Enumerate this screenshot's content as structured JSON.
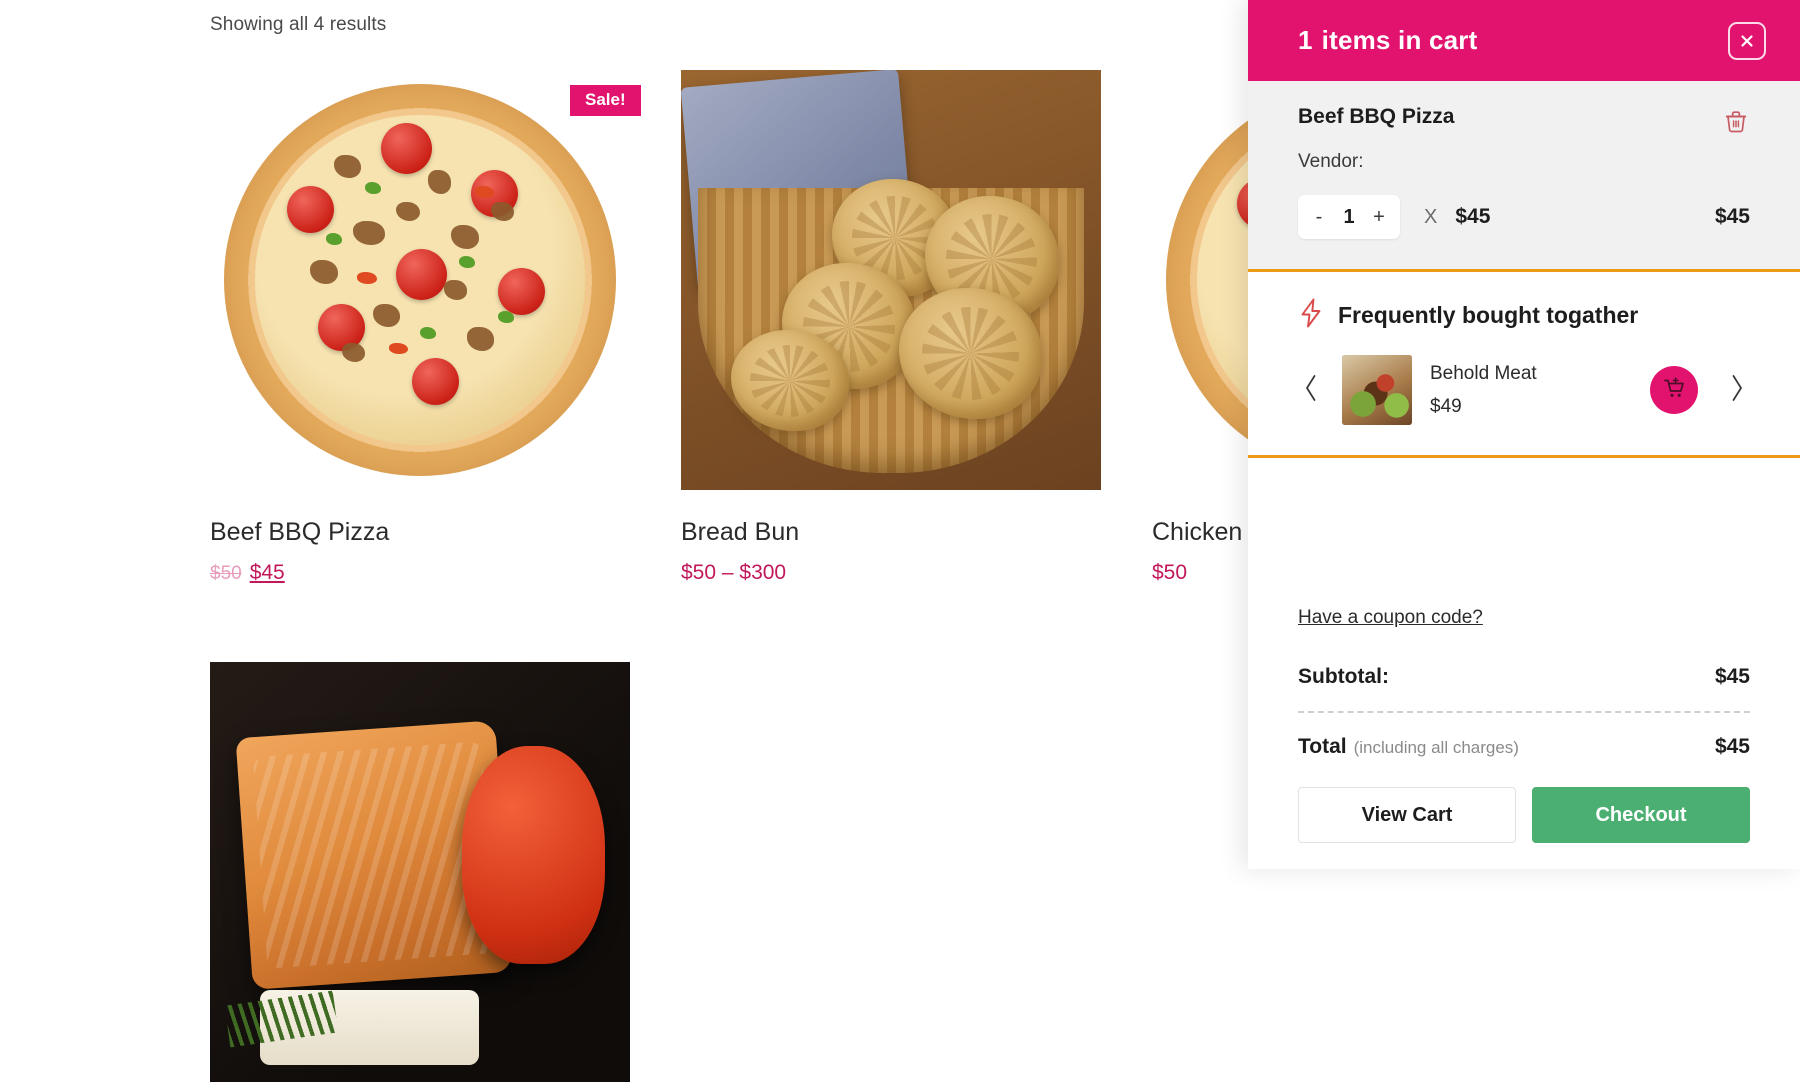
{
  "shop": {
    "results_text": "Showing all 4 results",
    "sale_badge": "Sale!",
    "products": [
      {
        "title": "Beef BBQ Pizza",
        "old_price": "$50",
        "price": "$45",
        "on_sale": true,
        "image": "beef-bbq-pizza-photo"
      },
      {
        "title": "Bread Bun",
        "price": "$50 – $300",
        "on_sale": false,
        "image": "bread-bun-basket-photo"
      },
      {
        "title": "Chicken",
        "price": "$50",
        "on_sale": false,
        "image": "chicken-pizza-photo"
      },
      {
        "title": "",
        "price": "",
        "on_sale": false,
        "image": "grilled-salmon-photo"
      }
    ]
  },
  "cart": {
    "header": {
      "count": "1",
      "title": "items in cart",
      "close_icon": "close-icon"
    },
    "item": {
      "name": "Beef BBQ Pizza",
      "vendor_label": "Vendor:",
      "vendor_value": "",
      "remove_icon": "trash-icon",
      "decrement": "-",
      "quantity": "1",
      "increment": "+",
      "multiply_symbol": "X",
      "unit_price": "$45",
      "line_total": "$45"
    },
    "frequently_bought": {
      "icon": "lightning-bolt-icon",
      "title": "Frequently bought togather",
      "prev_icon": "chevron-left-icon",
      "next_icon": "chevron-right-icon",
      "add_icon": "cart-plus-icon",
      "product": {
        "name": "Behold Meat",
        "price": "$49",
        "image": "behold-meat-thumbnail"
      }
    },
    "coupon_link": "Have a coupon code?",
    "subtotal_label": "Subtotal:",
    "subtotal_value": "$45",
    "total_label": "Total",
    "total_note": "(including all charges)",
    "total_value": "$45",
    "view_cart_label": "View Cart",
    "checkout_label": "Checkout"
  },
  "colors": {
    "brand_pink": "#e2136e",
    "accent_orange": "#eb9b16",
    "checkout_green": "#4caf72",
    "price_crimson": "#c2185b",
    "item_bg": "#f1f1f1"
  }
}
